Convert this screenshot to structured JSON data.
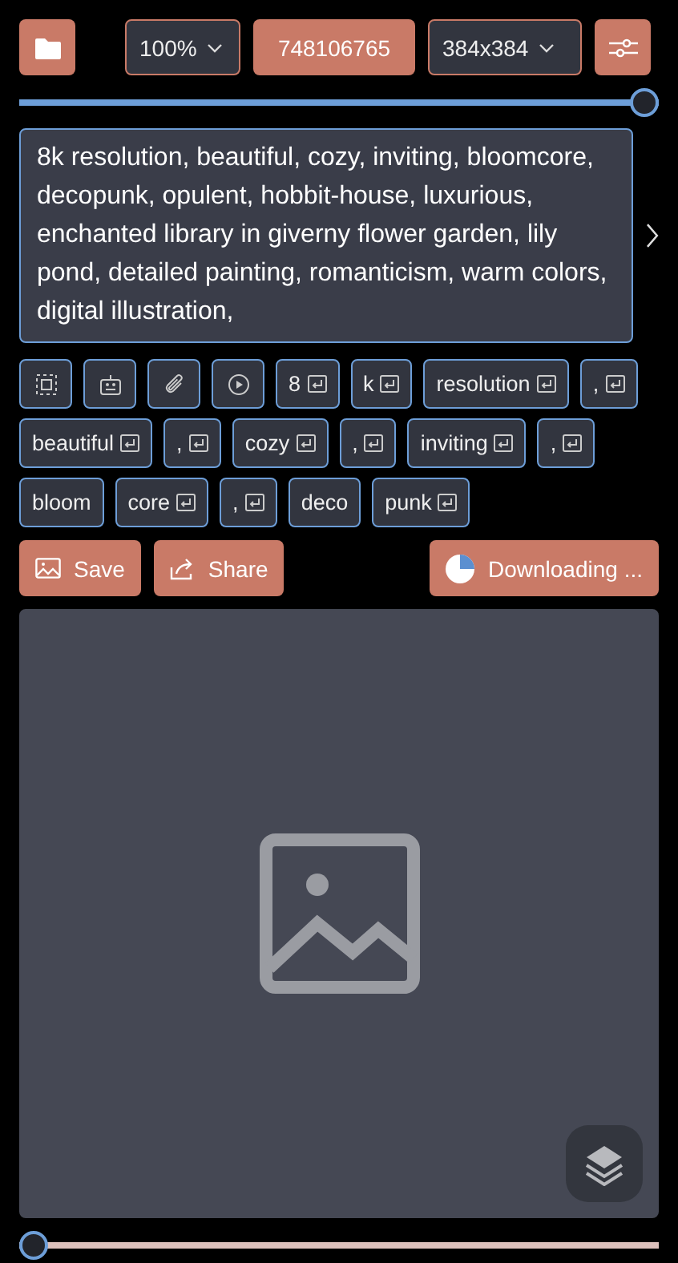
{
  "toolbar": {
    "zoom": "100%",
    "seed": "748106765",
    "size": "384x384"
  },
  "strength_slider": {
    "level": 1
  },
  "prompt": {
    "value": "8k resolution, beautiful, cozy, inviting, bloomcore, decopunk, opulent, hobbit-house, luxurious, enchanted library in giverny flower garden, lily pond, detailed painting, romanticism, warm colors, digital illustration,"
  },
  "tool_tokens": [
    {
      "kind": "select"
    },
    {
      "kind": "robot"
    },
    {
      "kind": "clip"
    },
    {
      "kind": "play"
    }
  ],
  "tokens": [
    {
      "text": "8",
      "enter": true
    },
    {
      "text": "k",
      "enter": true
    },
    {
      "text": "resolution",
      "enter": true
    },
    {
      "text": ",",
      "enter": true
    },
    {
      "text": "beautiful",
      "enter": true
    },
    {
      "text": ",",
      "enter": true
    },
    {
      "text": "cozy",
      "enter": true
    },
    {
      "text": ",",
      "enter": true
    },
    {
      "text": "inviting",
      "enter": true
    },
    {
      "text": ",",
      "enter": true
    },
    {
      "text": "bloom",
      "enter": false
    },
    {
      "text": "core",
      "enter": true
    },
    {
      "text": ",",
      "enter": true
    },
    {
      "text": "deco",
      "enter": false
    },
    {
      "text": "punk",
      "enter": true
    }
  ],
  "actions": {
    "save": "Save",
    "share": "Share",
    "download": "Downloading ..."
  },
  "step_slider": {
    "level": 0
  }
}
